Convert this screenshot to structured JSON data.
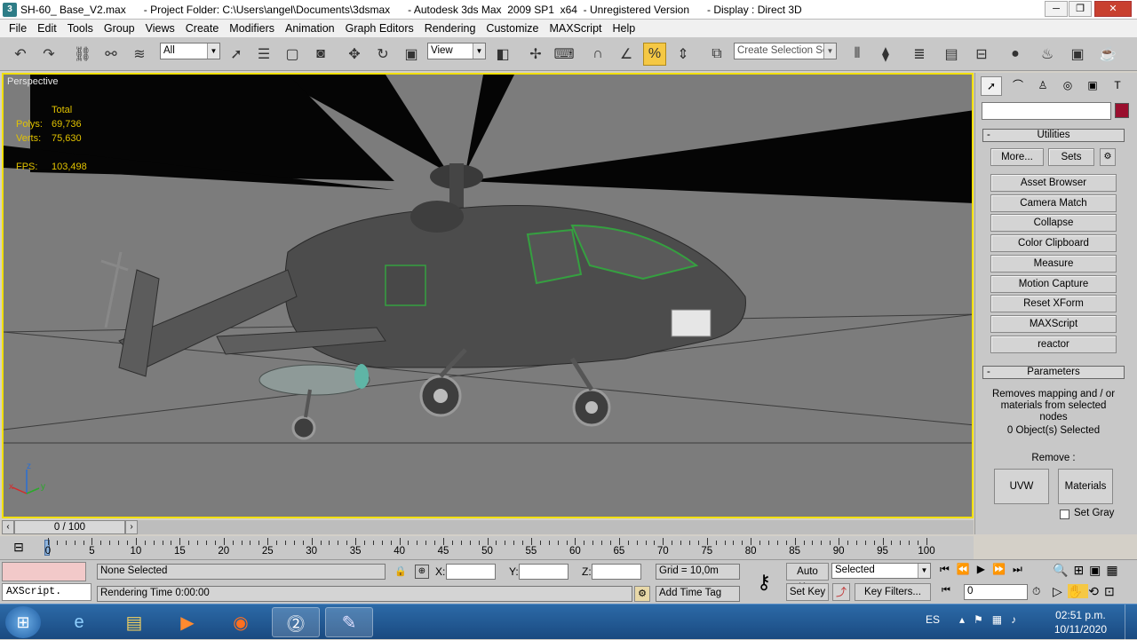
{
  "window": {
    "title": "SH-60_ Base_V2.max      - Project Folder: C:\\Users\\angel\\Documents\\3dsmax      - Autodesk 3ds Max  2009 SP1  x64  - Unregistered Version      - Display : Direct 3D",
    "minimize": "─",
    "restore": "❐",
    "close": "✕"
  },
  "menu": [
    "File",
    "Edit",
    "Tools",
    "Group",
    "Views",
    "Create",
    "Modifiers",
    "Animation",
    "Graph Editors",
    "Rendering",
    "Customize",
    "MAXScript",
    "Help"
  ],
  "toolbar": {
    "filter_value": "All",
    "refcoord_value": "View",
    "selection_set_placeholder": "Create Selection Set"
  },
  "viewport": {
    "label": "Perspective",
    "stats_header": "Total",
    "polys_label": "Polys:",
    "polys_value": "69,736",
    "verts_label": "Verts:",
    "verts_value": "75,630",
    "fps_label": "FPS:",
    "fps_value": "103,498",
    "axis_x": "x",
    "axis_y": "y",
    "axis_z": "z"
  },
  "command_panel": {
    "utilities_title": "Utilities",
    "more_button": "More...",
    "sets_button": "Sets",
    "utility_buttons": [
      "Asset Browser",
      "Camera Match",
      "Collapse",
      "Color Clipboard",
      "Measure",
      "Motion Capture",
      "Reset XForm",
      "MAXScript",
      "reactor"
    ],
    "parameters_title": "Parameters",
    "description": "Removes mapping and / or materials from selected nodes",
    "selected_count": "0 Object(s) Selected",
    "remove_label": "Remove :",
    "uvw_button": "UVW",
    "materials_button": "Materials",
    "set_gray_label": "Set Gray",
    "color_swatch": "#9a0f2e"
  },
  "timeline": {
    "frame_display": "0 / 100",
    "ticks": [
      "0",
      "5",
      "10",
      "15",
      "20",
      "25",
      "30",
      "35",
      "40",
      "45",
      "50",
      "55",
      "60",
      "65",
      "70",
      "75",
      "80",
      "85",
      "90",
      "95",
      "100"
    ]
  },
  "status": {
    "maxscript_listener": "AXScript.",
    "selection_status": "None Selected",
    "rendering_time": "Rendering Time  0:00:00",
    "x_label": "X:",
    "y_label": "Y:",
    "z_label": "Z:",
    "grid": "Grid = 10,0m",
    "add_time_tag": "Add Time Tag",
    "auto_key": "Auto Key",
    "set_key": "Set Key",
    "key_mode_value": "Selected",
    "key_filters": "Key Filters...",
    "current_frame": "0"
  },
  "taskbar": {
    "language": "ES",
    "time": "02:51 p.m.",
    "date": "10/11/2020"
  }
}
